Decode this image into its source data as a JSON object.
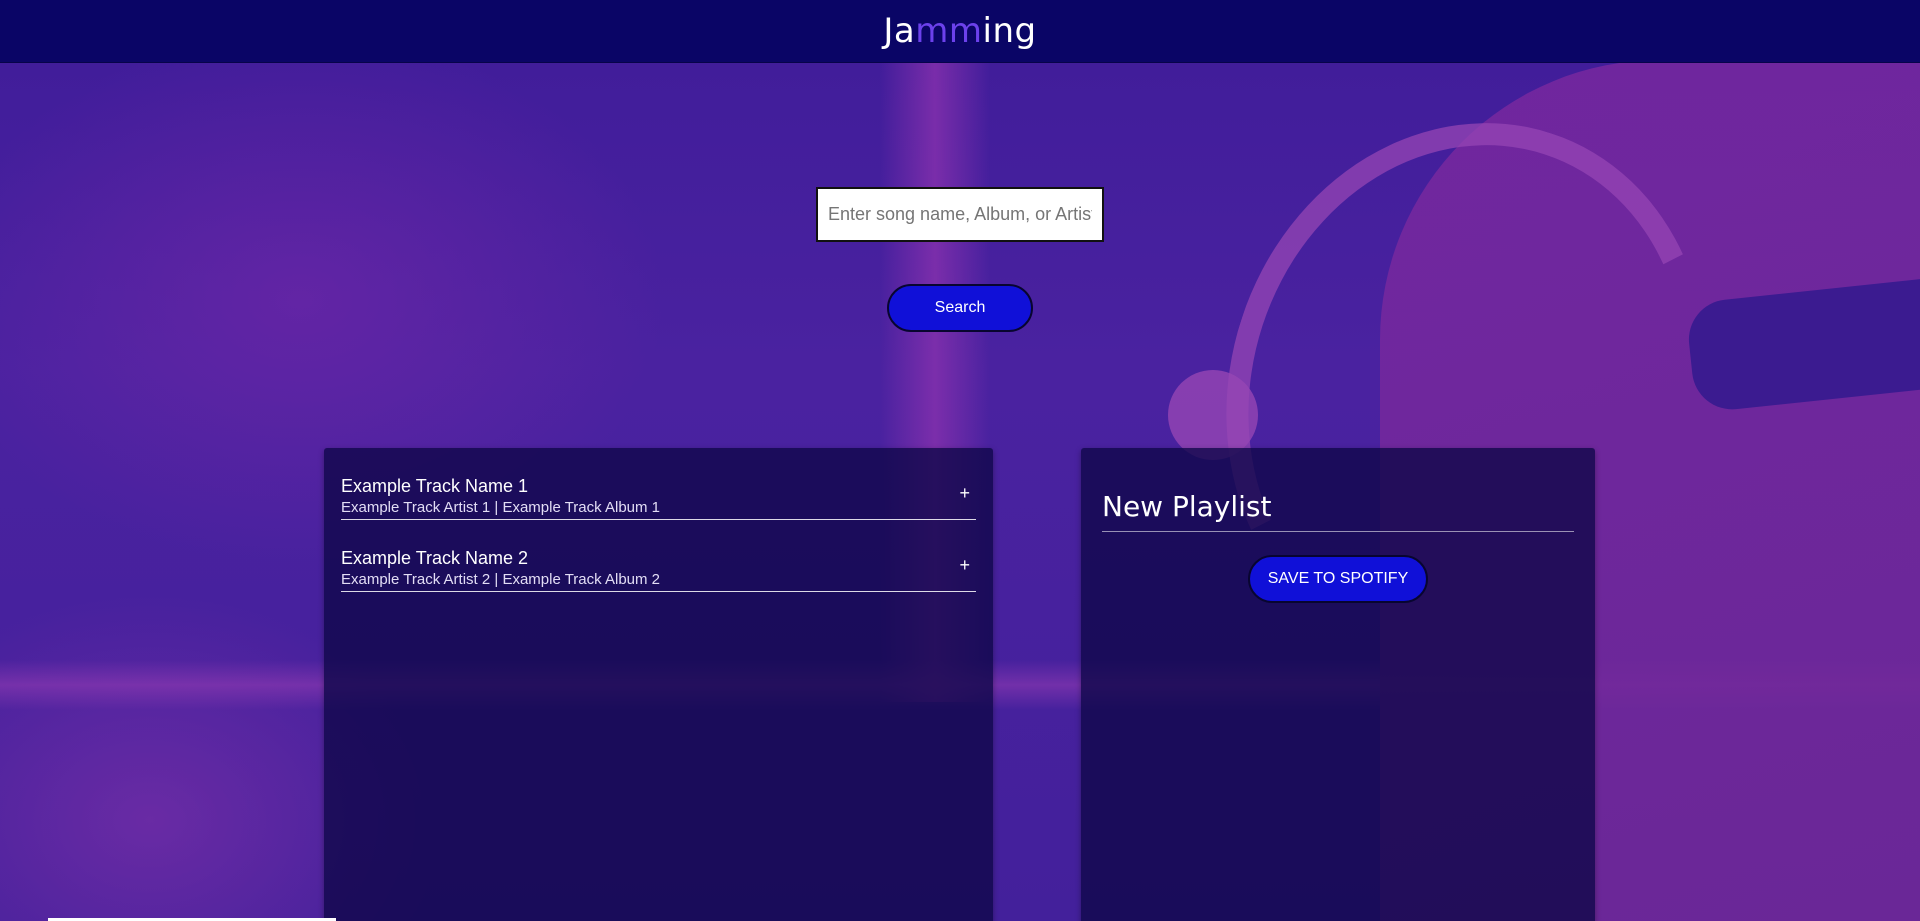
{
  "header": {
    "logo_prefix": "Ja",
    "logo_highlight": "mm",
    "logo_suffix": "ing"
  },
  "search": {
    "placeholder": "Enter song name, Album, or Artist",
    "value": "",
    "button_label": "Search"
  },
  "results": {
    "tracks": [
      {
        "name": "Example Track Name 1",
        "meta": "Example Track Artist 1 | Example Track Album 1",
        "action": "+"
      },
      {
        "name": "Example Track Name 2",
        "meta": "Example Track Artist 2 | Example Track Album 2",
        "action": "+"
      }
    ]
  },
  "playlist": {
    "title": "New Playlist",
    "save_label": "SAVE TO SPOTIFY"
  },
  "colors": {
    "header_bg": "#0a0566",
    "logo_accent": "#6c41ec",
    "button_bg": "#1010d8",
    "panel_bg": "#0e0648"
  },
  "icons": {
    "add_track": "plus-icon"
  }
}
